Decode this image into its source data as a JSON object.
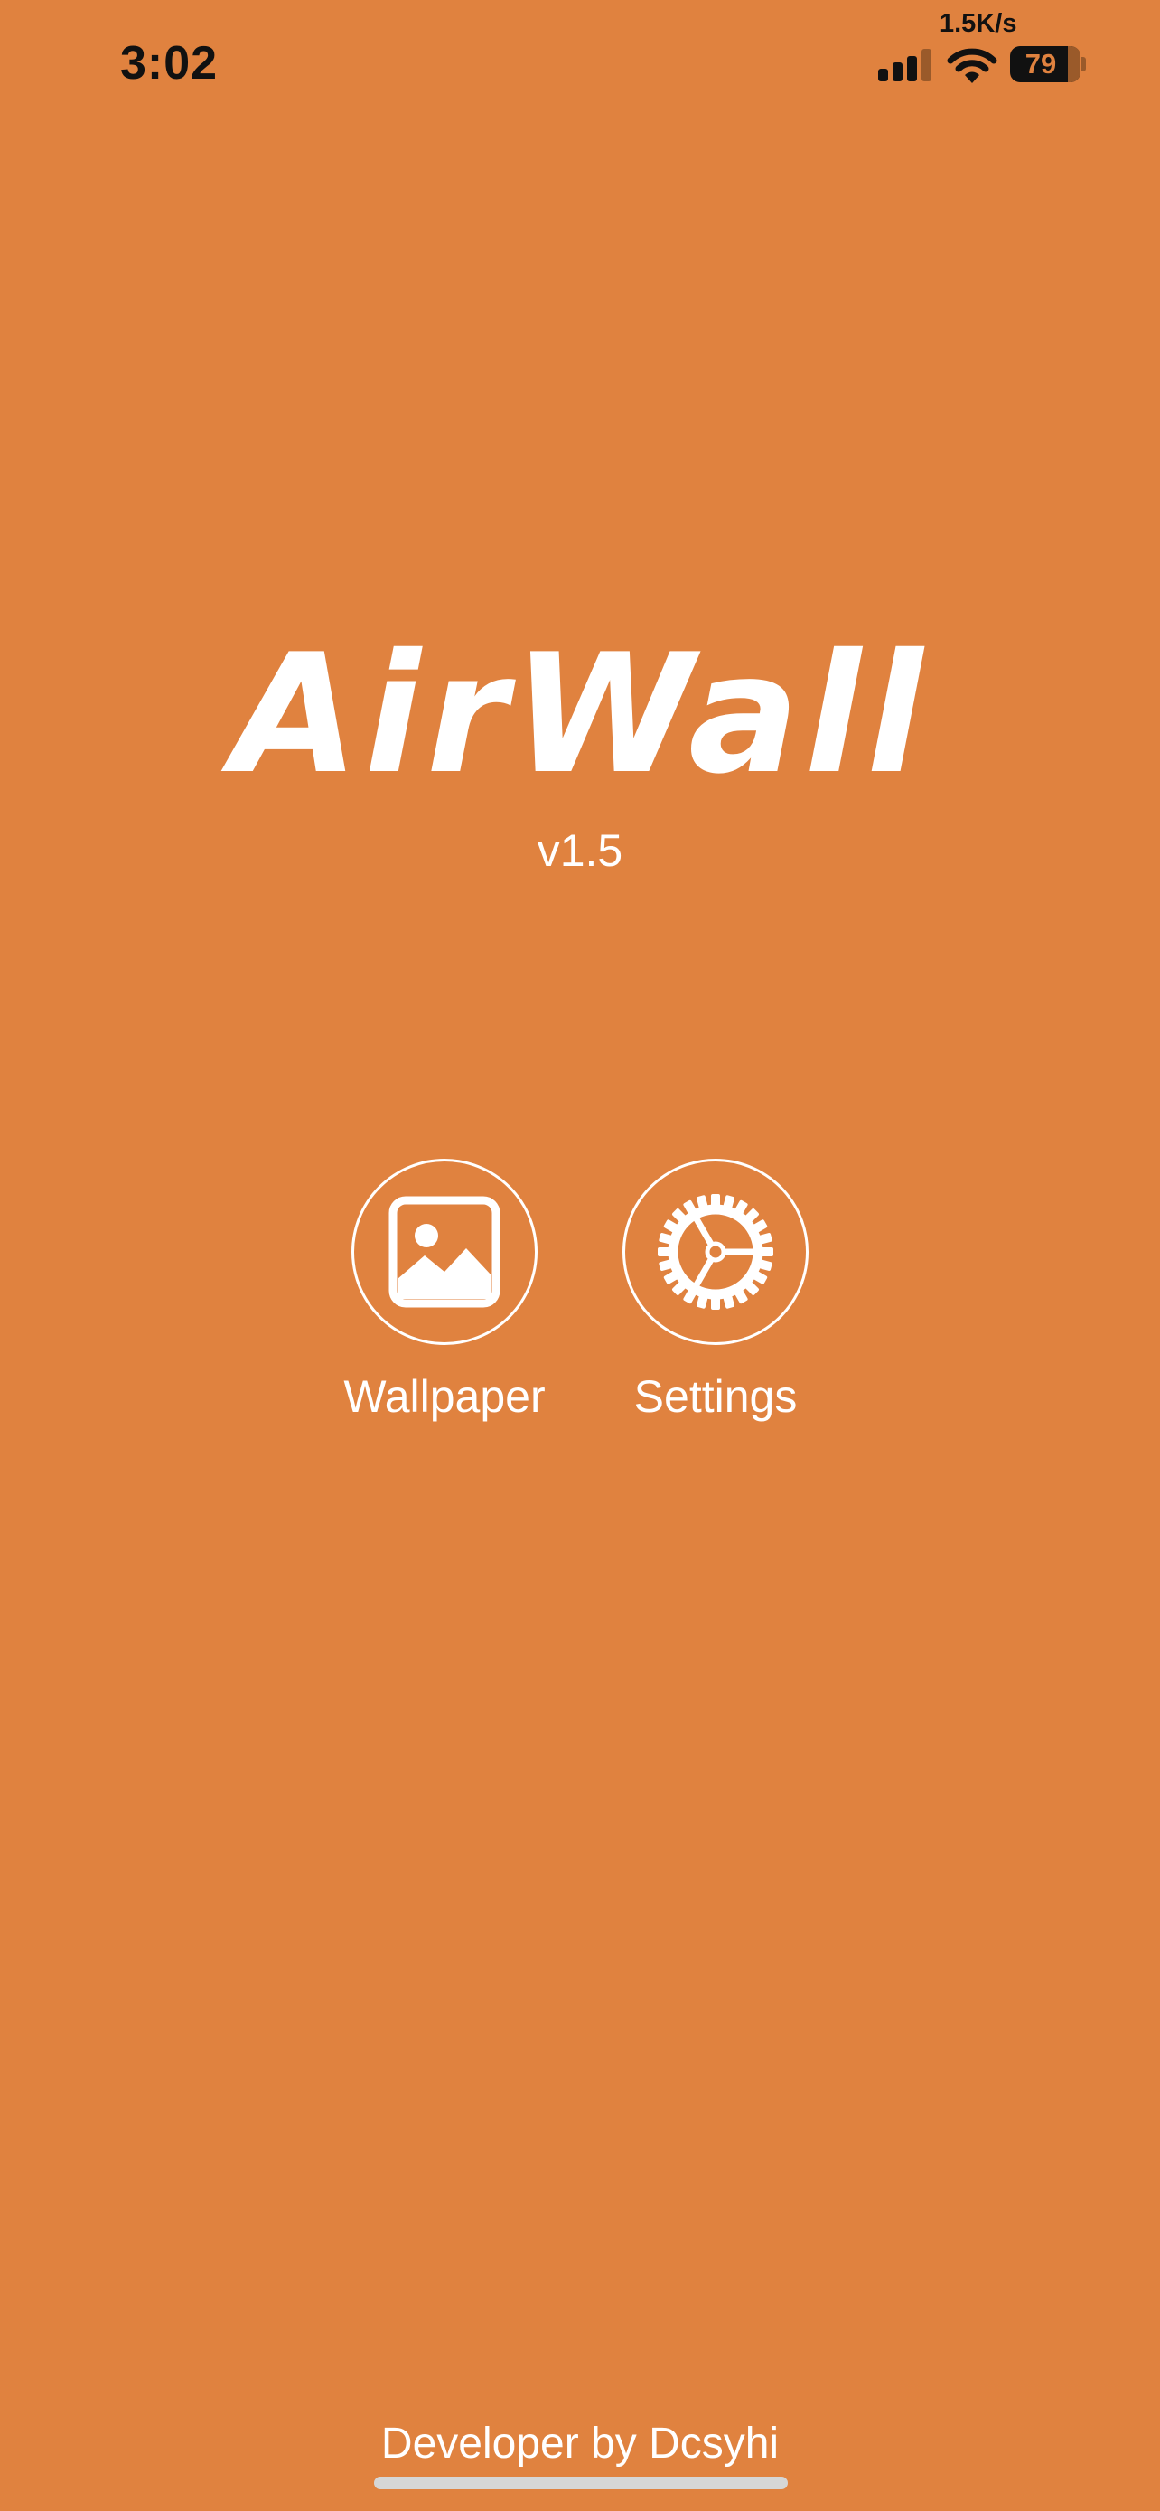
{
  "status_bar": {
    "time": "3:02",
    "network_speed": "1.5K/s",
    "battery_level": "79",
    "icons": [
      "cellular-signal-icon",
      "wifi-icon",
      "battery-icon"
    ]
  },
  "app": {
    "title": "AirWall",
    "version": "v1.5"
  },
  "actions": [
    {
      "label": "Wallpaper",
      "icon": "image-icon"
    },
    {
      "label": "Settings",
      "icon": "gear-icon"
    }
  ],
  "footer": {
    "credit": "Developer by Dcsyhi"
  },
  "colors": {
    "background": "#E0823F",
    "foreground": "#FFFFFF",
    "status_text": "#111111"
  }
}
